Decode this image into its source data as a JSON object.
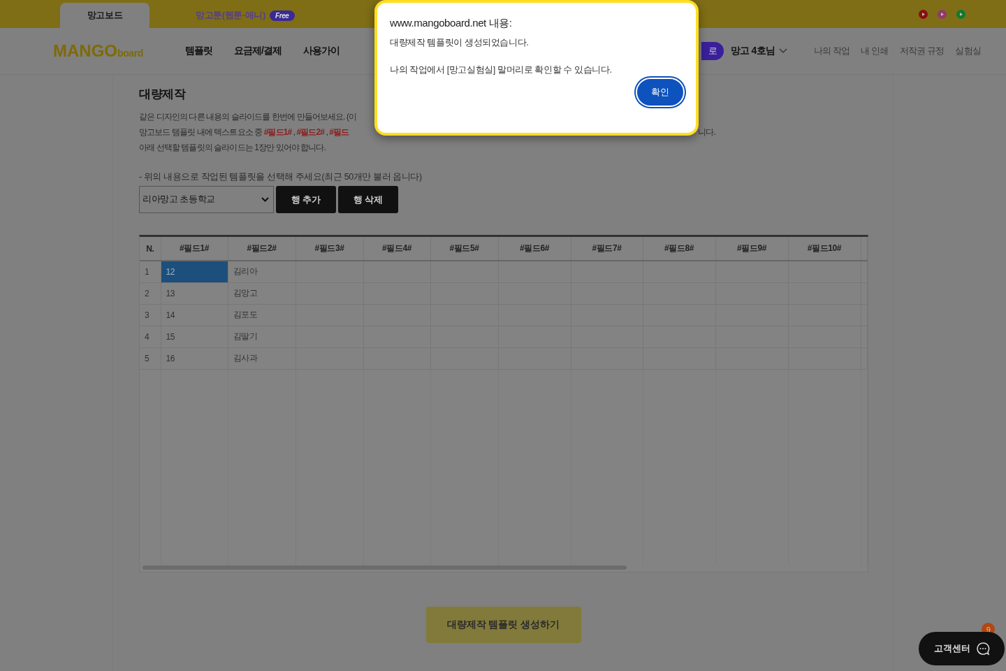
{
  "top_tabs": [
    {
      "label": "망고보드",
      "selected": true
    },
    {
      "label": "망고툰(웹툰·애니)",
      "badge": "Free",
      "selected": false
    }
  ],
  "nav": {
    "logo": {
      "main": "MANGO",
      "sub": "board"
    },
    "menu": [
      "템플릿",
      "요금제/결제",
      "사용가이"
    ],
    "partial_button": "로",
    "user": "망고 4호님",
    "links": [
      "나의 작업",
      "내 인쇄",
      "저작권 규정",
      "실험실"
    ]
  },
  "content": {
    "title": "대량제작",
    "description": [
      {
        "segments": [
          {
            "kind": "plain",
            "text": "같은 디자인의 다른 내용의 슬라이드를 한번에 만들어보세요. (이"
          }
        ]
      },
      {
        "segments": [
          {
            "kind": "plain",
            "text": "망고보드 템플릿 내에 텍스트요소 중 "
          },
          {
            "kind": "field",
            "text": "#필드1#"
          },
          {
            "kind": "plain",
            "text": " , "
          },
          {
            "kind": "field",
            "text": "#필드2#"
          },
          {
            "kind": "plain",
            "text": " , "
          },
          {
            "kind": "field",
            "text": "#필드"
          }
        ],
        "tail": "니다."
      },
      {
        "segments": [
          {
            "kind": "plain",
            "text": "아래 선택할 템플릿의 슬라이드는 1장만 있어야 합니다."
          }
        ]
      }
    ],
    "select_prompt": "- 위의 내용으로 작업된 템플릿을 선택해 주세요(최근 50개만 불러 옵니다)",
    "template_select": "리아망고 초등학교",
    "row_buttons": [
      "행 추가",
      "행 삭제"
    ],
    "table": {
      "columns": [
        "N.",
        "#필드1#",
        "#필드2#",
        "#필드3#",
        "#필드4#",
        "#필드5#",
        "#필드6#",
        "#필드7#",
        "#필드8#",
        "#필드9#",
        "#필드10#"
      ],
      "rows": [
        {
          "cells": [
            {
              "text": "1",
              "selected": false
            },
            {
              "text": "12",
              "selected": true
            },
            {
              "text": "김리아",
              "selected": false
            }
          ]
        },
        {
          "cells": [
            {
              "text": "2",
              "selected": false
            },
            {
              "text": "13",
              "selected": false
            },
            {
              "text": "김망고",
              "selected": false
            }
          ]
        },
        {
          "cells": [
            {
              "text": "3",
              "selected": false
            },
            {
              "text": "14",
              "selected": false
            },
            {
              "text": "김포도",
              "selected": false
            }
          ]
        },
        {
          "cells": [
            {
              "text": "4",
              "selected": false
            },
            {
              "text": "15",
              "selected": false
            },
            {
              "text": "김딸기",
              "selected": false
            }
          ]
        },
        {
          "cells": [
            {
              "text": "5",
              "selected": false
            },
            {
              "text": "16",
              "selected": false
            },
            {
              "text": "김사과",
              "selected": false
            }
          ]
        }
      ]
    },
    "generate_button": "대량제작 템플릿 생성하기"
  },
  "help_button": {
    "label": "고객센터",
    "badge": "9"
  },
  "dialog": {
    "title": "www.mangoboard.net 내용:",
    "messages": [
      "대량제작 템플릿이 생성되었습니다.",
      "나의 작업에서 [망고실험실] 말머리로 확인할 수 있습니다."
    ],
    "ok_button": "확인"
  }
}
